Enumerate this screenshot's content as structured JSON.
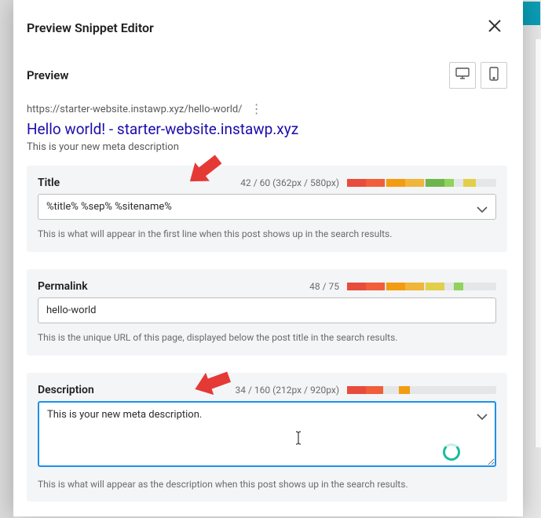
{
  "header": {
    "title": "Preview Snippet Editor"
  },
  "preview": {
    "label": "Preview",
    "url": "https://starter-website.instawp.xyz/hello-world/",
    "title": "Hello world! - starter-website.instawp.xyz",
    "description": "This is your new meta description"
  },
  "fields": {
    "title": {
      "label": "Title",
      "counter": "42 / 60 (362px / 580px)",
      "value": "%title% %sep% %sitename%",
      "helper": "This is what will appear in the first line when this post shows up in the search results."
    },
    "permalink": {
      "label": "Permalink",
      "counter": "48 / 75",
      "value": "hello-world",
      "helper": "This is the unique URL of this page, displayed below the post title in the search results."
    },
    "description": {
      "label": "Description",
      "counter": "34 / 160 (212px / 920px)",
      "value": "This is your new meta description.",
      "helper": "This is what will appear as the description when this post shows up in the search results."
    }
  }
}
